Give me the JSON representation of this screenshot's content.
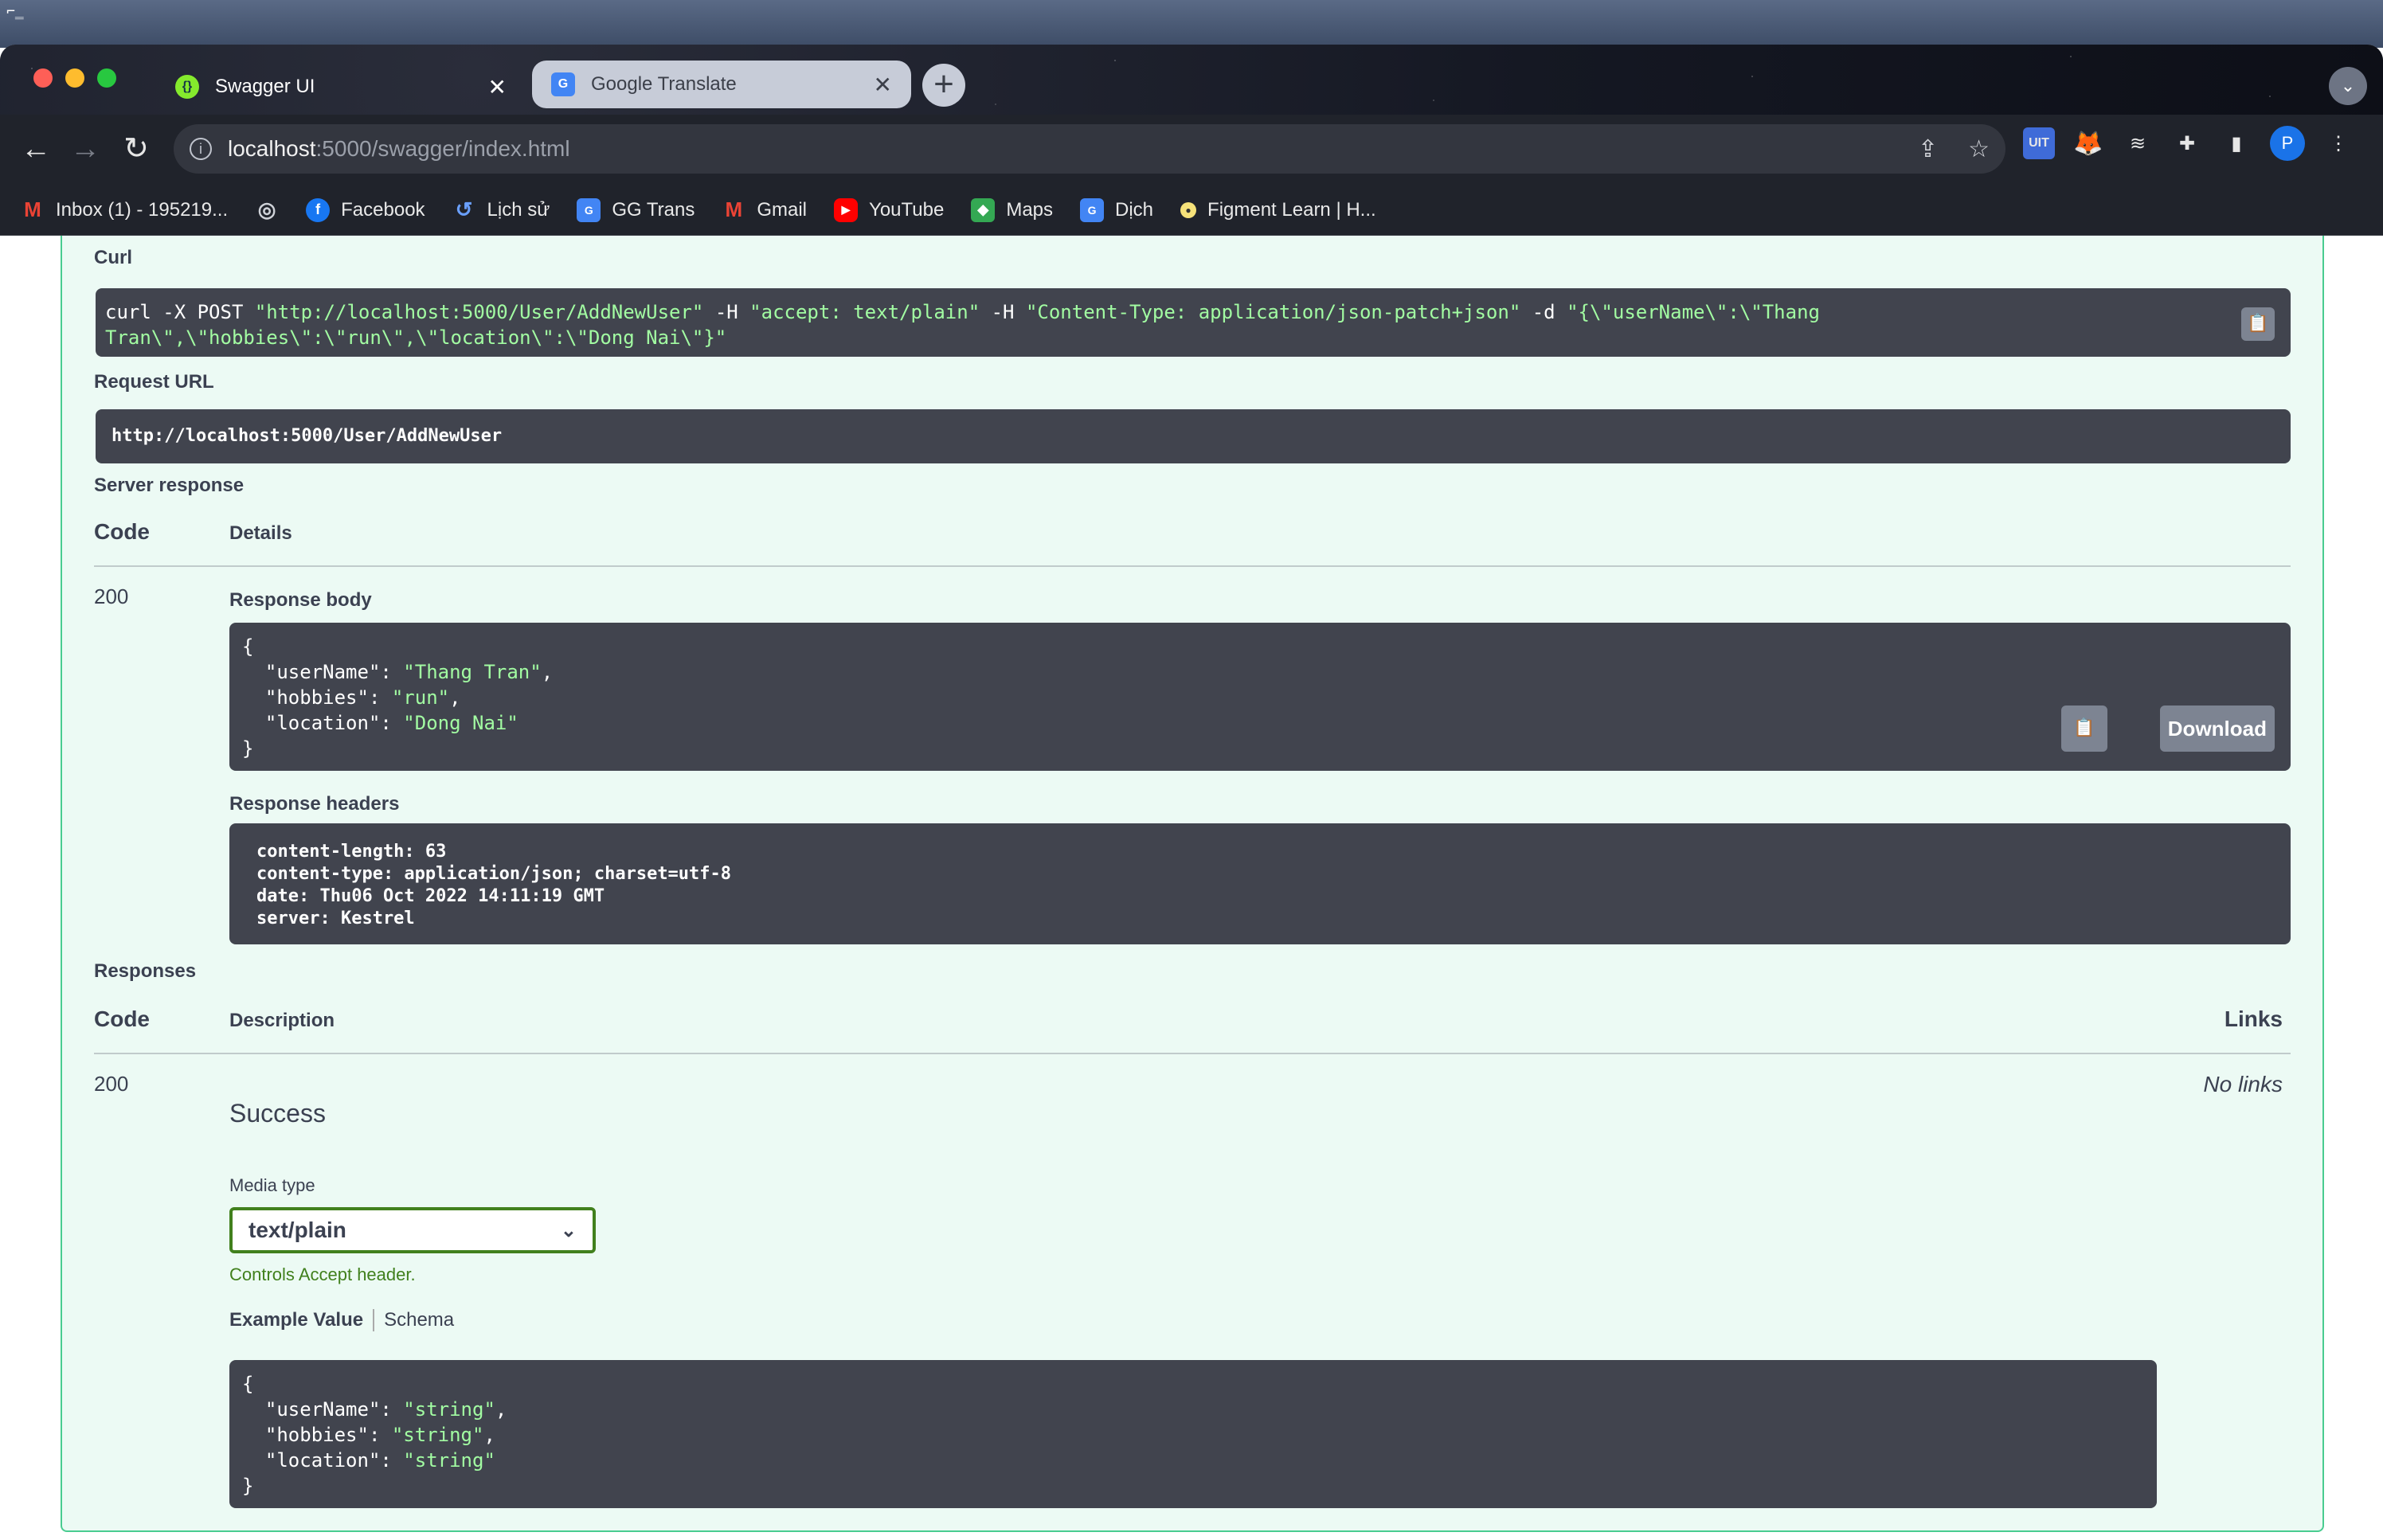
{
  "tabs": [
    {
      "title": "Swagger UI"
    },
    {
      "title": "Google Translate"
    }
  ],
  "address": {
    "host": "localhost",
    "path": ":5000/swagger/index.html"
  },
  "bookmarks": [
    {
      "label": "Inbox (1) - 195219...",
      "icon": "gmail-icon"
    },
    {
      "label": "",
      "icon": "globe-icon"
    },
    {
      "label": "Facebook",
      "icon": "facebook-icon"
    },
    {
      "label": "Lịch sử",
      "icon": "history-icon"
    },
    {
      "label": "GG Trans",
      "icon": "google-translate-icon"
    },
    {
      "label": "Gmail",
      "icon": "gmail-icon"
    },
    {
      "label": "YouTube",
      "icon": "youtube-icon"
    },
    {
      "label": "Maps",
      "icon": "maps-icon"
    },
    {
      "label": "Dịch",
      "icon": "google-translate-icon"
    },
    {
      "label": "Figment Learn | H...",
      "icon": "figment-icon"
    }
  ],
  "curl": {
    "label": "Curl",
    "cmd_start": "curl -X POST ",
    "url_str": "\"http://localhost:5000/User/AddNewUser\"",
    "h1": " -H  ",
    "accept_str": "\"accept: text/plain\"",
    "h2": " -H  ",
    "ctype_str": "\"Content-Type: application/json-patch+json\"",
    "d": " -d ",
    "body_str_1": "\"{\\\"userName\\\":\\\"Thang",
    "body_str_2": "Tran\\\",\\\"hobbies\\\":\\\"run\\\",\\\"location\\\":\\\"Dong Nai\\\"}\""
  },
  "request_url": {
    "label": "Request URL",
    "value": "http://localhost:5000/User/AddNewUser"
  },
  "server_response": {
    "label": "Server response",
    "code_header": "Code",
    "details_header": "Details",
    "code": "200",
    "body_label": "Response body",
    "body": {
      "userName": "Thang Tran",
      "hobbies": "run",
      "location": "Dong Nai"
    },
    "download_label": "Download",
    "headers_label": "Response headers",
    "headers": [
      "content-length: 63",
      "content-type: application/json; charset=utf-8",
      "date: Thu06 Oct 2022 14:11:19 GMT",
      "server: Kestrel"
    ]
  },
  "responses": {
    "label": "Responses",
    "code_header": "Code",
    "description_header": "Description",
    "links_header": "Links",
    "code": "200",
    "description": "Success",
    "links": "No links",
    "media_type_label": "Media type",
    "media_type_value": "text/plain",
    "controls_note": "Controls Accept header.",
    "example_tab": "Example Value",
    "schema_tab": "Schema",
    "example": {
      "userName": "string",
      "hobbies": "string",
      "location": "string"
    }
  }
}
